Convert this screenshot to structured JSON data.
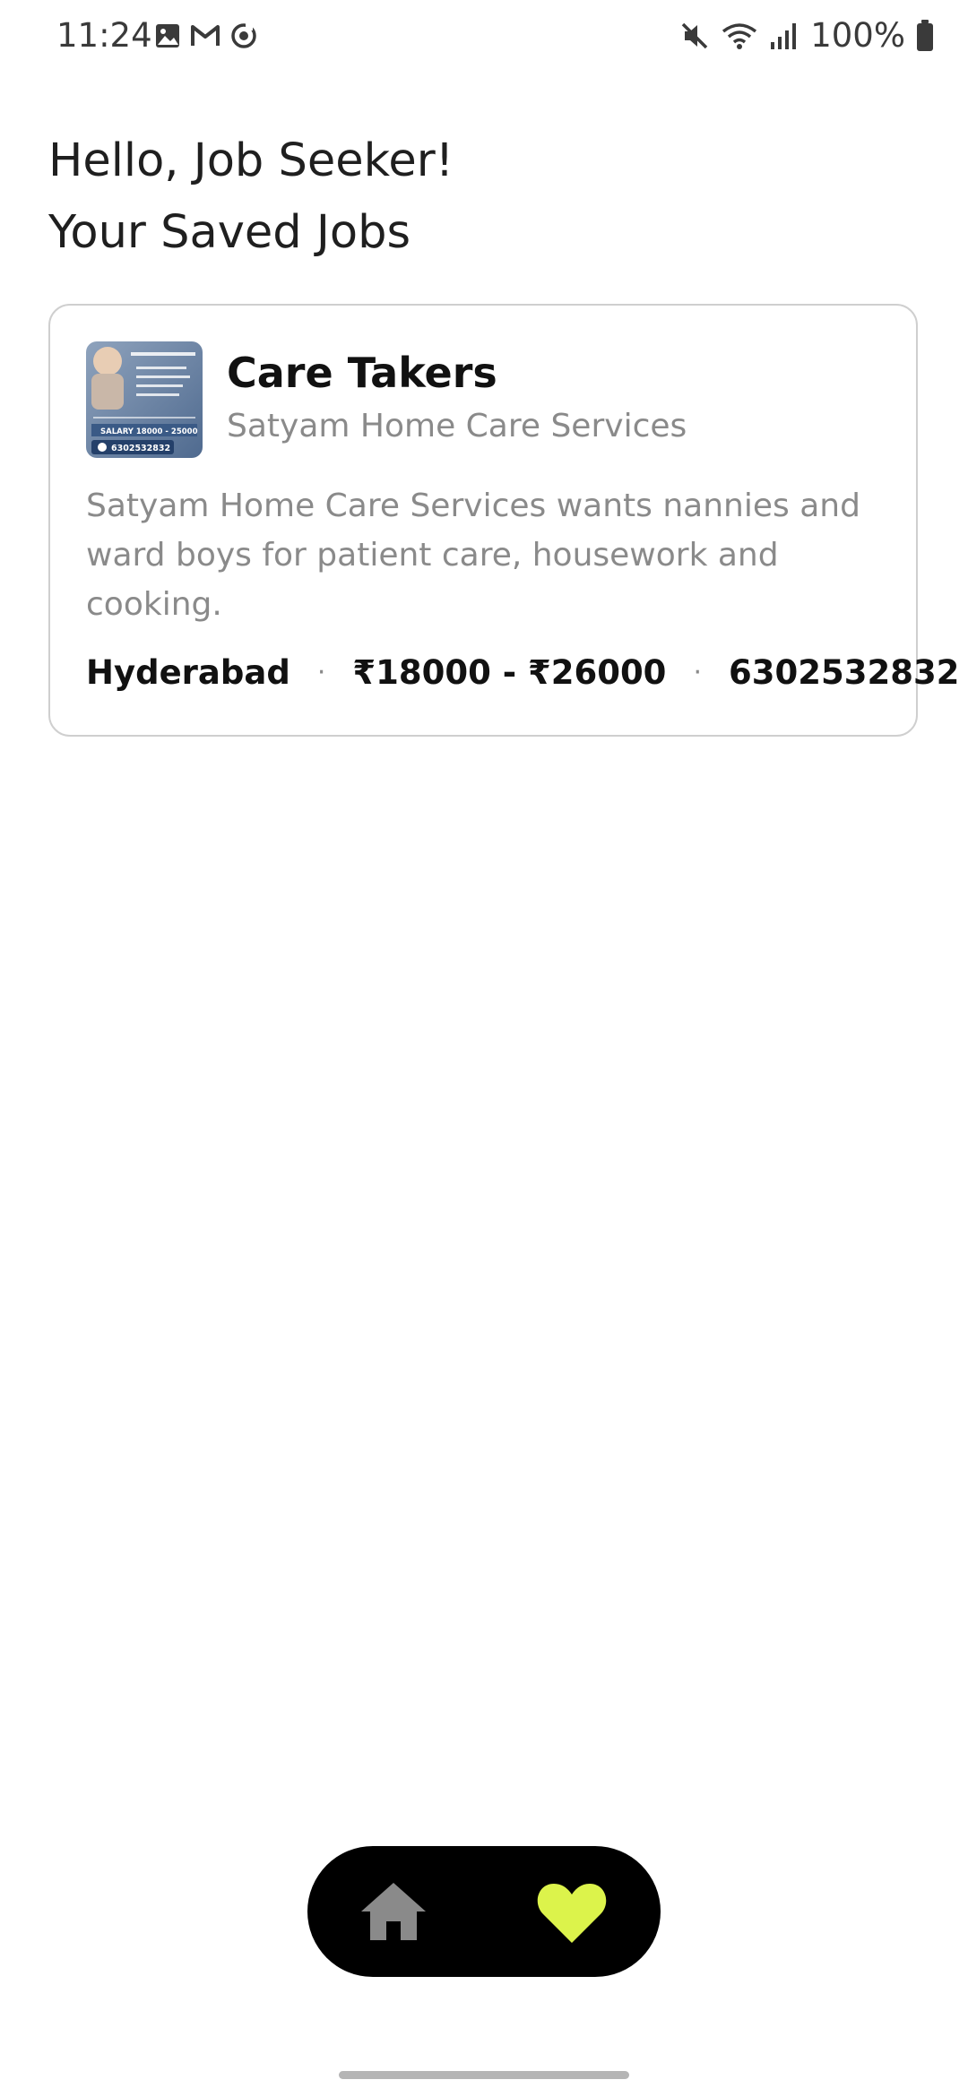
{
  "status_bar": {
    "time": "11:24",
    "battery": "100%",
    "icons_left": [
      "gallery-icon",
      "gmail-icon",
      "sync-icon"
    ],
    "icons_right": [
      "mute-icon",
      "wifi-icon",
      "signal-icon",
      "battery-icon"
    ]
  },
  "header": {
    "greeting": "Hello, Job Seeker!",
    "subtitle": "Your Saved Jobs"
  },
  "jobs": [
    {
      "title": "Care Takers",
      "company": "Satyam Home Care Services",
      "description": "Satyam Home Care Services wants nannies and ward boys for patient care, housework and cooking.",
      "location": "Hyderabad",
      "salary": "₹18000 - ₹26000",
      "phone": "6302532832",
      "thumbnail_text": {
        "salary": "SALARY 18000 - 25000",
        "phone": "6302532832"
      }
    }
  ],
  "nav": {
    "items": [
      {
        "name": "home",
        "icon": "home-icon",
        "active": false
      },
      {
        "name": "saved",
        "icon": "heart-icon",
        "active": true
      }
    ],
    "active_color": "#dcf34b",
    "inactive_color": "#8a8a8a"
  }
}
